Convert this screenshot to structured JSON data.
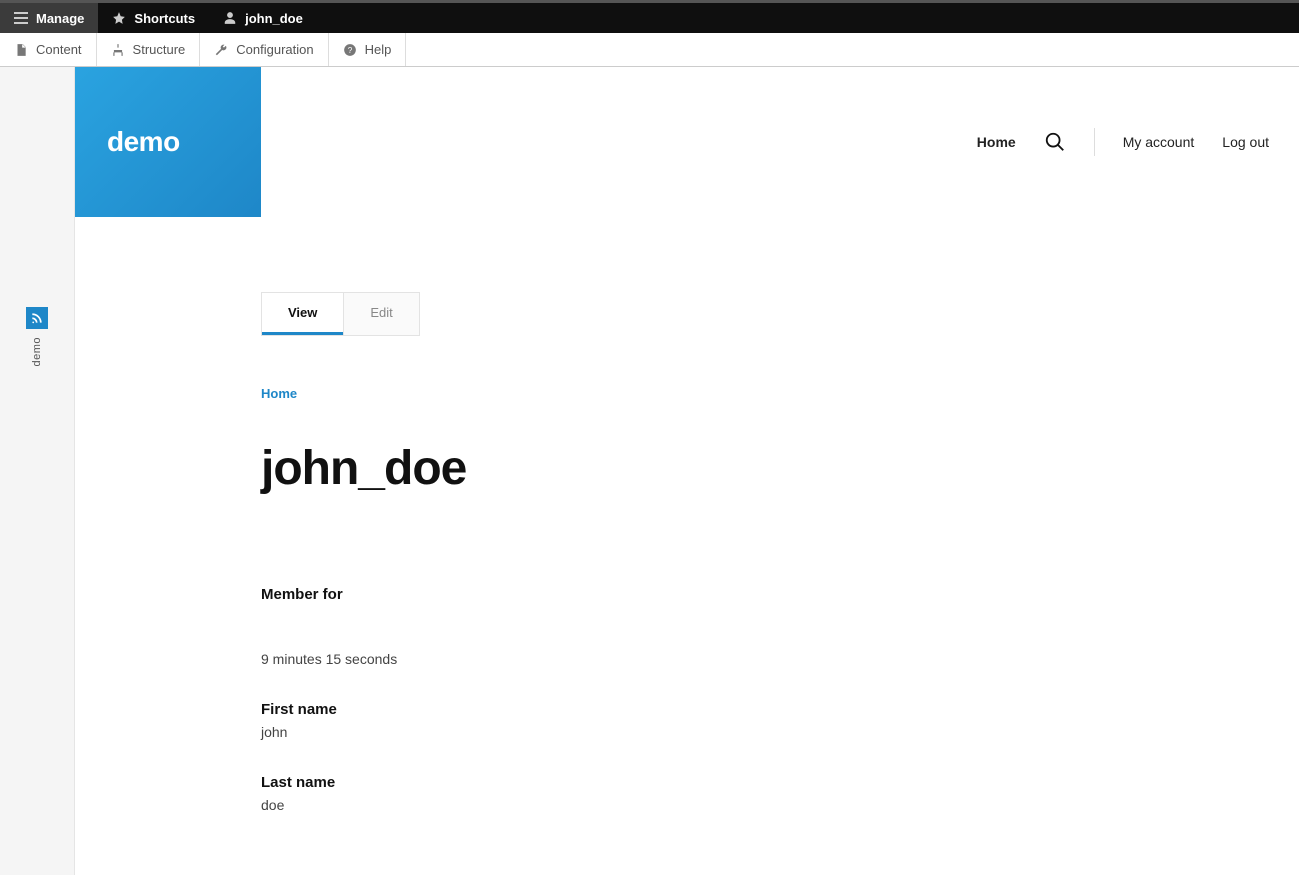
{
  "admin_bar": {
    "manage": "Manage",
    "shortcuts": "Shortcuts",
    "user": "john_doe"
  },
  "toolbar": {
    "content": "Content",
    "structure": "Structure",
    "configuration": "Configuration",
    "help": "Help"
  },
  "side_rail": {
    "label": "demo"
  },
  "logo": {
    "text": "demo"
  },
  "header_nav": {
    "home": "Home",
    "my_account": "My account",
    "log_out": "Log out"
  },
  "tabs": {
    "view": "View",
    "edit": "Edit"
  },
  "breadcrumb": {
    "home": "Home"
  },
  "page": {
    "title": "john_doe"
  },
  "profile": {
    "member_for_label": "Member for",
    "member_for_value": "9 minutes 15 seconds",
    "first_name_label": "First name",
    "first_name_value": "john",
    "last_name_label": "Last name",
    "last_name_value": "doe"
  }
}
